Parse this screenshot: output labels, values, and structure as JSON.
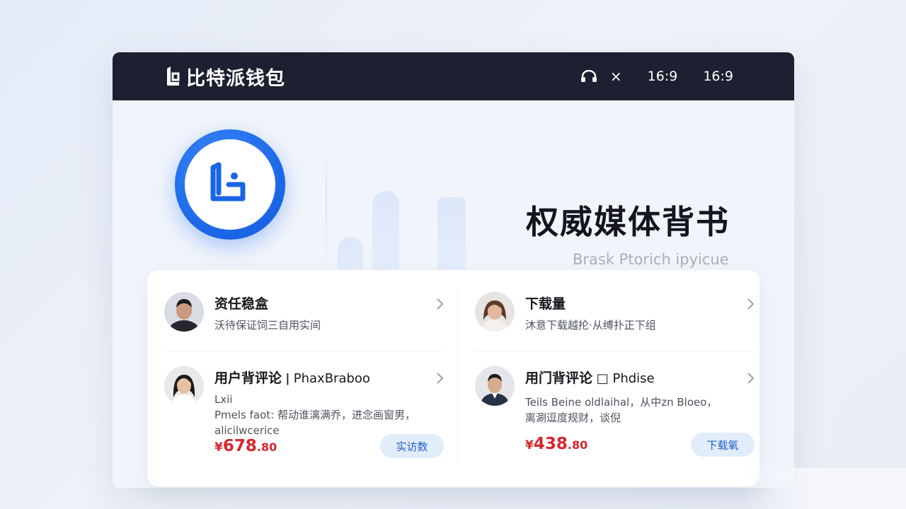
{
  "titlebar": {
    "app_name": "比特派钱包",
    "close_glyph": "×",
    "ratio_1": "16:9",
    "ratio_2": "16:9"
  },
  "hero": {
    "title": "权威媒体背书",
    "subtitle": "Brask Ptorich ipyicue",
    "logo_icon": "bitpie-logo-icon"
  },
  "items": [
    {
      "title": "资任稳盒",
      "title_extra": "",
      "desc_lines": [
        "沃待保证饲三自用实间"
      ],
      "price": null,
      "button": null
    },
    {
      "title": "下载量",
      "title_extra": "",
      "desc_lines": [
        "沐意下载越抡·从缚扑正下组"
      ],
      "price": null,
      "button": null
    },
    {
      "title": "用户背评论",
      "title_extra": " ǀ PhaxBraboo",
      "desc_lines": [
        "Lxii",
        "Pmels faot: 帮动谁漓满乔，进念画窗男，",
        "alicilwcerice"
      ],
      "price": {
        "currency": "¥",
        "int": "678",
        "dec": ".80"
      },
      "button": "实访数"
    },
    {
      "title": "用门背评论",
      "title_extra": " □ Phdise",
      "desc_lines": [
        "Teils Beine oldlaihal，从中zn Bloeo，",
        "离涮逗度规财，谈倪"
      ],
      "price": {
        "currency": "¥",
        "int": "438",
        "dec": ".80"
      },
      "button": "下载氧"
    }
  ],
  "colors": {
    "titlebar_bg": "#1c2030",
    "accent_blue": "#1a64e6",
    "price_red": "#d7262d",
    "pill_bg": "#e2edfb"
  },
  "icons": {
    "brand": "bitpie-brand-icon",
    "headset": "headset-icon",
    "chevron": "chevron-right-icon"
  }
}
